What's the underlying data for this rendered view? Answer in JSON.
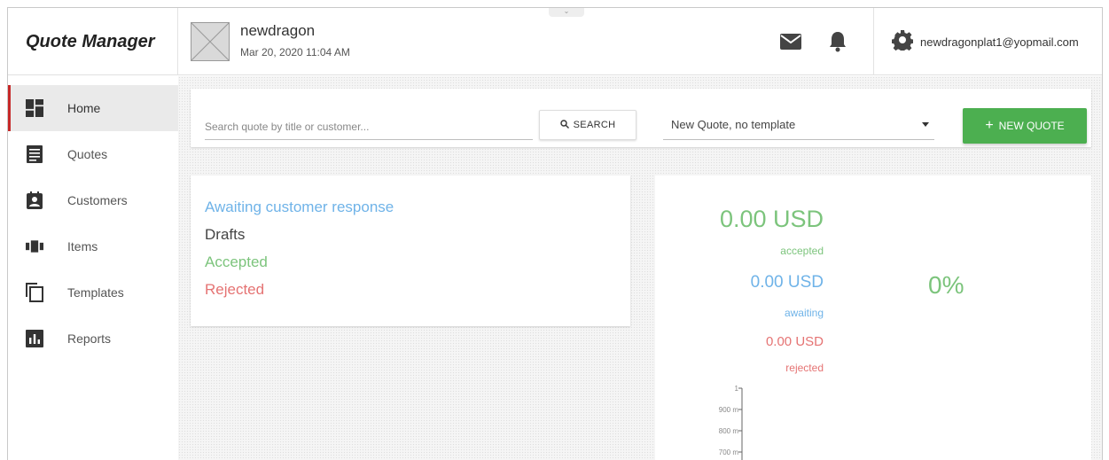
{
  "app": {
    "title": "Quote Manager"
  },
  "header": {
    "user_name": "newdragon",
    "user_date": "Mar 20, 2020 11:04 AM",
    "collapse_glyph": "⌄",
    "account_email": "newdragonplat1@yopmail.com"
  },
  "sidebar": {
    "items": [
      {
        "label": "Home",
        "icon": "dashboard-icon"
      },
      {
        "label": "Quotes",
        "icon": "quote-list-icon"
      },
      {
        "label": "Customers",
        "icon": "contact-card-icon"
      },
      {
        "label": "Items",
        "icon": "items-icon"
      },
      {
        "label": "Templates",
        "icon": "copy-icon"
      },
      {
        "label": "Reports",
        "icon": "bar-chart-icon"
      }
    ],
    "active": "Home"
  },
  "toolbar": {
    "search_placeholder": "Search quote by title or customer...",
    "search_label": "SEARCH",
    "template_value": "New Quote, no template",
    "new_quote_label": "NEW QUOTE"
  },
  "status": {
    "awaiting": "Awaiting customer response",
    "drafts": "Drafts",
    "accepted": "Accepted",
    "rejected": "Rejected"
  },
  "summary": {
    "accepted_amount": "0.00 USD",
    "accepted_label": "accepted",
    "awaiting_amount": "0.00 USD",
    "awaiting_label": "awaiting",
    "rejected_amount": "0.00 USD",
    "rejected_label": "rejected",
    "percent": "0%",
    "axis_ticks": [
      "1",
      "900 m",
      "800 m",
      "700 m"
    ]
  },
  "colors": {
    "brand_red": "#c62828",
    "green": "#4caf50",
    "accepted_green": "#7cc47c",
    "awaiting_blue": "#6fb3e8",
    "rejected_red": "#e57373"
  }
}
